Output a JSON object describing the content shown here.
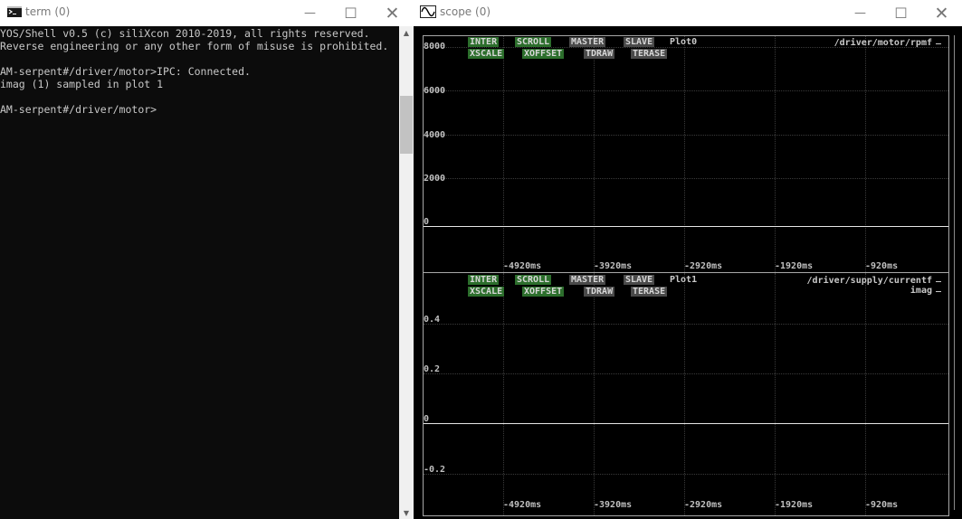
{
  "term": {
    "title": "term (0)",
    "lines": [
      "YOS/Shell v0.5 (c) siliXcon 2010-2019, all rights reserved.",
      "Reverse engineering or any other form of misuse is prohibited.",
      "",
      "AM-serpent#/driver/motor>IPC: Connected.",
      "imag (1) sampled in plot 1",
      "",
      "AM-serpent#/driver/motor>"
    ],
    "buttons": {
      "min": "—",
      "max": "☐",
      "close": "✕"
    }
  },
  "scope": {
    "title": "scope (0)",
    "buttons": {
      "min": "—",
      "max": "☐",
      "close": "✕"
    },
    "plots": [
      {
        "name": "Plot0",
        "toggles_row1": [
          {
            "label": "INTER",
            "active": true
          },
          {
            "label": "SCROLL",
            "active": true
          },
          {
            "label": "MASTER",
            "active": false
          },
          {
            "label": "SLAVE",
            "active": false
          }
        ],
        "toggles_row2": [
          {
            "label": "XSCALE",
            "active": true
          },
          {
            "label": "XOFFSET",
            "active": true
          },
          {
            "label": "TDRAW",
            "active": false
          },
          {
            "label": "TERASE",
            "active": false
          }
        ],
        "signals": [
          "/driver/motor/rpmf"
        ],
        "y_ticks": [
          "8000",
          "6000",
          "4000",
          "2000",
          "0"
        ],
        "x_ticks": [
          "-4920ms",
          "-3920ms",
          "-2920ms",
          "-1920ms",
          "-920ms"
        ]
      },
      {
        "name": "Plot1",
        "toggles_row1": [
          {
            "label": "INTER",
            "active": true
          },
          {
            "label": "SCROLL",
            "active": true
          },
          {
            "label": "MASTER",
            "active": false
          },
          {
            "label": "SLAVE",
            "active": false
          }
        ],
        "toggles_row2": [
          {
            "label": "XSCALE",
            "active": true
          },
          {
            "label": "XOFFSET",
            "active": true
          },
          {
            "label": "TDRAW",
            "active": false
          },
          {
            "label": "TERASE",
            "active": false
          }
        ],
        "signals": [
          "/driver/supply/currentf",
          "imag"
        ],
        "y_ticks": [
          "0.4",
          "0.2",
          "0",
          "-0.2"
        ],
        "x_ticks": [
          "-4920ms",
          "-3920ms",
          "-2920ms",
          "-1920ms",
          "-920ms"
        ]
      }
    ]
  },
  "colors": {
    "chip_on": "#2c6e2c",
    "chip_off": "#4a4a4a",
    "term_bg": "#0c0c0c",
    "scope_bg": "#000000"
  }
}
